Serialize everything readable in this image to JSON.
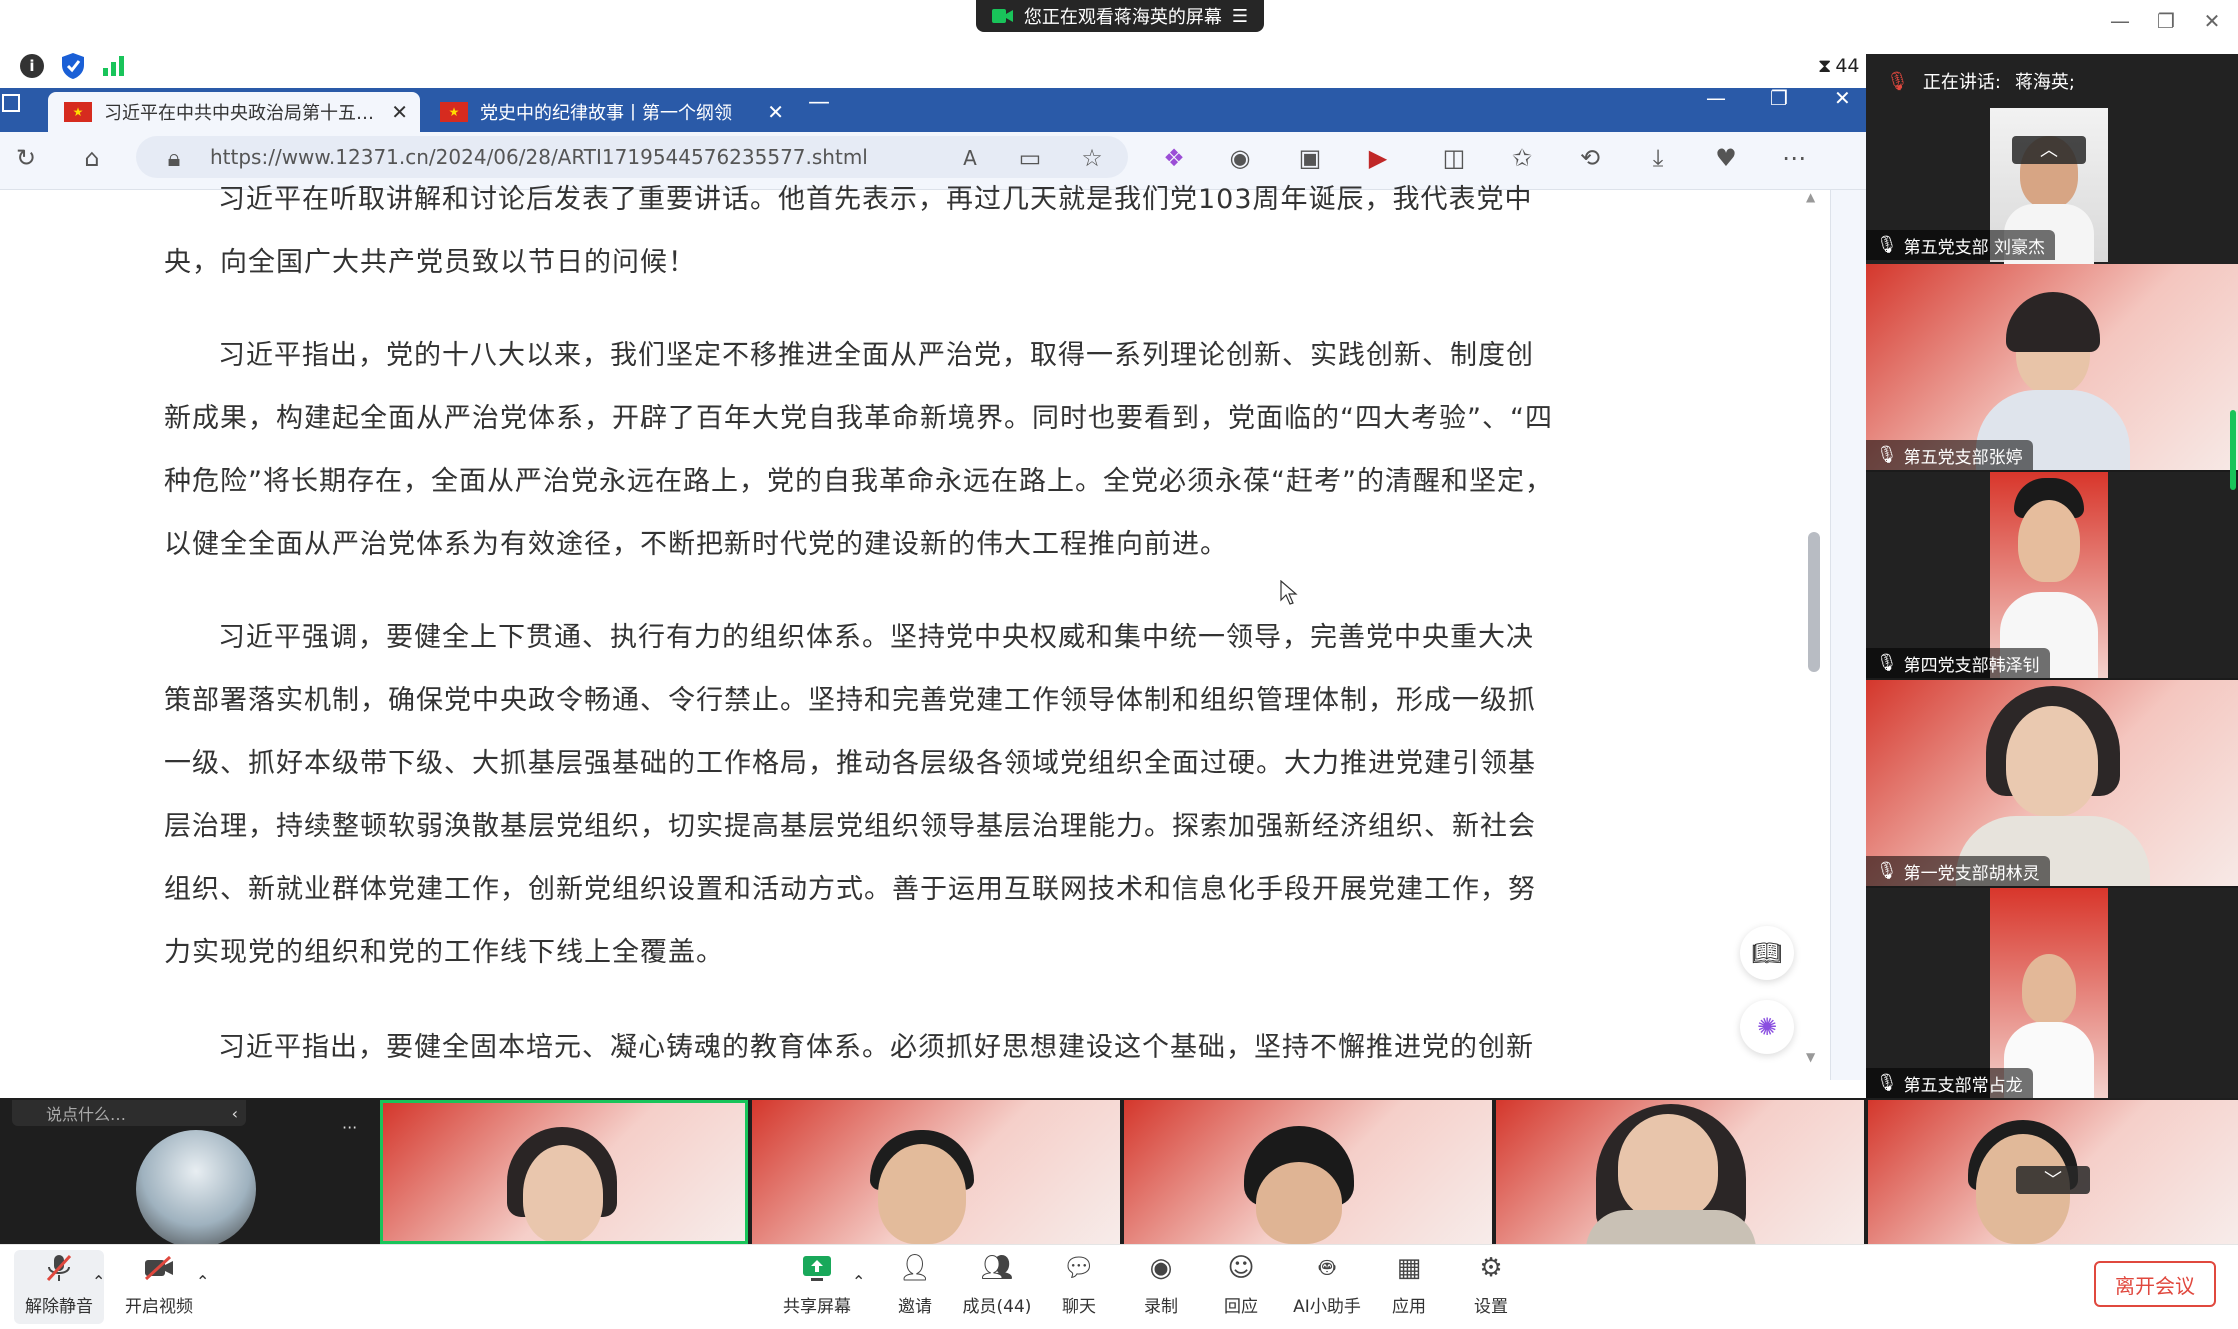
{
  "banner": {
    "text": "您正在观看蒋海英的屏幕",
    "menu_icon": "menu-icon"
  },
  "window_controls": [
    "minimize",
    "restore",
    "close"
  ],
  "meeting": {
    "timer_partial": "44"
  },
  "browser": {
    "tabs": [
      {
        "label": "习近平在中共中央政治局第十五…",
        "close": "✕"
      },
      {
        "label": "党史中的纪律故事丨第一个纲领",
        "close": "✕"
      }
    ],
    "url": "https://www.12371.cn/2024/06/28/ARTI1719544576235577.shtml",
    "paragraphs": [
      "习近平在听取讲解和讨论后发表了重要讲话。他首先表示，再过几天就是我们党103周年诞辰，我代表党中央，向全国广大共产党员致以节日的问候！",
      "习近平指出，党的十八大以来，我们坚定不移推进全面从严治党，取得一系列理论创新、实践创新、制度创新成果，构建起全面从严治党体系，开辟了百年大党自我革命新境界。同时也要看到，党面临的“四大考验”、“四种危险”将长期存在，全面从严治党永远在路上，党的自我革命永远在路上。全党必须永葆“赶考”的清醒和坚定，以健全全面从严治党体系为有效途径，不断把新时代党的建设新的伟大工程推向前进。",
      "习近平强调，要健全上下贯通、执行有力的组织体系。坚持党中央权威和集中统一领导，完善党中央重大决策部署落实机制，确保党中央政令畅通、令行禁止。坚持和完善党建工作领导体制和组织管理体制，形成一级抓一级、抓好本级带下级、大抓基层强基础的工作格局，推动各层级各领域党组织全面过硬。大力推进党建引领基层治理，持续整顿软弱涣散基层党组织，切实提高基层党组织领导基层治理能力。探索加强新经济组织、新社会组织、新就业群体党建工作，创新党组织设置和活动方式。善于运用互联网技术和信息化手段开展党建工作，努力实现党的组织和党的工作线下线上全覆盖。",
      "习近平指出，要健全固本培元、凝心铸魂的教育体系。必须抓好思想建设这个基础，坚持不懈推进党的创新理"
    ]
  },
  "right_panel": {
    "speaking_label": "正在讲话:",
    "speaking_name": "蒋海英;",
    "participants": [
      {
        "name": "第五党支部 刘豪杰"
      },
      {
        "name": "第五党支部张婷"
      },
      {
        "name": "第四党支部韩泽钊"
      },
      {
        "name": "第一党支部胡林灵"
      },
      {
        "name": "第五支部常占龙"
      }
    ]
  },
  "strip": {
    "chat_placeholder": "说点什么…",
    "more": "···"
  },
  "toolbar": {
    "left": [
      {
        "label": "解除静音",
        "icon": "mic-muted-icon"
      },
      {
        "label": "开启视频",
        "icon": "video-off-icon"
      }
    ],
    "center": [
      {
        "label": "共享屏幕",
        "icon": "share-screen-icon"
      },
      {
        "label": "邀请",
        "icon": "invite-icon"
      },
      {
        "label": "成员(44)",
        "icon": "members-icon"
      },
      {
        "label": "聊天",
        "icon": "chat-icon"
      },
      {
        "label": "录制",
        "icon": "record-icon"
      },
      {
        "label": "回应",
        "icon": "reaction-icon"
      },
      {
        "label": "AI小助手",
        "icon": "ai-assistant-icon"
      },
      {
        "label": "应用",
        "icon": "apps-icon"
      },
      {
        "label": "设置",
        "icon": "settings-icon"
      }
    ],
    "leave": "离开会议"
  },
  "colors": {
    "accent_blue": "#2a5aa8",
    "party_red": "#d62b1f",
    "leave_red": "#e0483e",
    "active_green": "#19c45a"
  }
}
